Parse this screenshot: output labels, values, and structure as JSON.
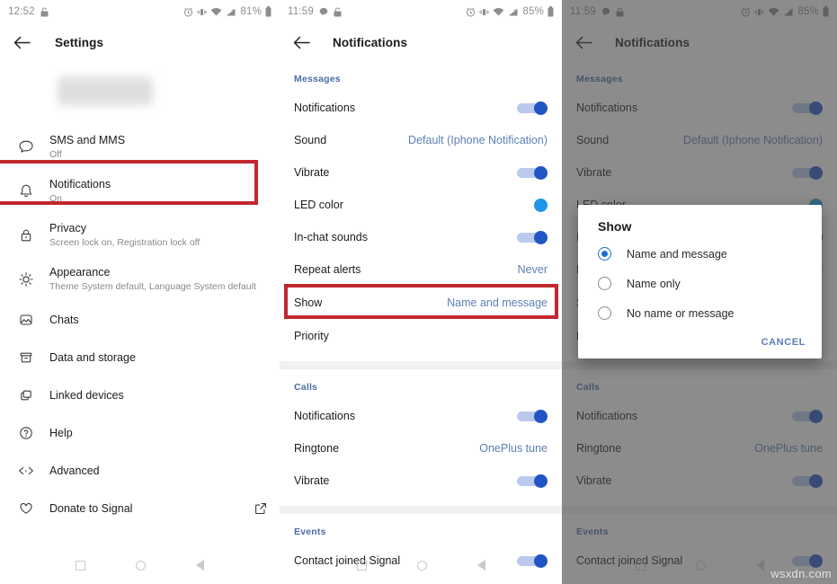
{
  "colors": {
    "accent_blue": "#5b7fb5",
    "section_header": "#4a6fa5",
    "toggle_on": "#2255c4",
    "led_dot": "#1f95e8",
    "highlight_red": "#c1272d",
    "radio_selected": "#1f6fd4"
  },
  "panel_settings": {
    "statusbar": {
      "time": "12:52",
      "battery_percent": "81%",
      "left_icons": [
        "lock-icon"
      ],
      "right_icons": [
        "alarm-icon",
        "vibrate-icon",
        "wifi-icon",
        "signal-icon",
        "battery-icon"
      ]
    },
    "appbar": {
      "title": "Settings",
      "back_icon": "back-arrow-icon"
    },
    "profile": {
      "name_blurred": ""
    },
    "items": [
      {
        "icon": "chat-bubble-icon",
        "title": "SMS and MMS",
        "subtitle": "Off",
        "highlighted": false,
        "external": false
      },
      {
        "icon": "bell-icon",
        "title": "Notifications",
        "subtitle": "On",
        "highlighted": true,
        "external": false
      },
      {
        "icon": "lock-icon",
        "title": "Privacy",
        "subtitle": "Screen lock on, Registration lock off",
        "highlighted": false,
        "external": false
      },
      {
        "icon": "brightness-icon",
        "title": "Appearance",
        "subtitle": "Theme System default, Language System default",
        "highlighted": false,
        "external": false
      },
      {
        "icon": "image-icon",
        "title": "Chats",
        "subtitle": "",
        "highlighted": false,
        "external": false
      },
      {
        "icon": "archive-icon",
        "title": "Data and storage",
        "subtitle": "",
        "highlighted": false,
        "external": false
      },
      {
        "icon": "devices-icon",
        "title": "Linked devices",
        "subtitle": "",
        "highlighted": false,
        "external": false
      },
      {
        "icon": "help-icon",
        "title": "Help",
        "subtitle": "",
        "highlighted": false,
        "external": false
      },
      {
        "icon": "code-icon",
        "title": "Advanced",
        "subtitle": "",
        "highlighted": false,
        "external": false
      },
      {
        "icon": "heart-icon",
        "title": "Donate to Signal",
        "subtitle": "",
        "highlighted": false,
        "external": true
      }
    ],
    "navbar": [
      "square-icon",
      "circle-icon",
      "triangle-back-icon"
    ]
  },
  "panel_notifications": {
    "statusbar": {
      "time": "11:59",
      "battery_percent": "85%",
      "left_icons": [
        "message-icon",
        "lock-icon"
      ],
      "right_icons": [
        "alarm-icon",
        "vibrate-icon",
        "wifi-icon",
        "signal-icon",
        "battery-icon"
      ]
    },
    "appbar": {
      "title": "Notifications",
      "back_icon": "back-arrow-icon"
    },
    "sections": [
      {
        "header": "Messages",
        "rows": [
          {
            "label": "Notifications",
            "type": "toggle",
            "value": "on"
          },
          {
            "label": "Sound",
            "type": "value",
            "value": "Default (Iphone Notification)"
          },
          {
            "label": "Vibrate",
            "type": "toggle",
            "value": "on"
          },
          {
            "label": "LED color",
            "type": "color-dot",
            "value": "blue"
          },
          {
            "label": "In-chat sounds",
            "type": "toggle",
            "value": "on"
          },
          {
            "label": "Repeat alerts",
            "type": "value",
            "value": "Never"
          },
          {
            "label": "Show",
            "type": "value",
            "value": "Name and message",
            "highlighted": true
          },
          {
            "label": "Priority",
            "type": "plain",
            "value": ""
          }
        ]
      },
      {
        "header": "Calls",
        "rows": [
          {
            "label": "Notifications",
            "type": "toggle",
            "value": "on"
          },
          {
            "label": "Ringtone",
            "type": "value",
            "value": "OnePlus tune"
          },
          {
            "label": "Vibrate",
            "type": "toggle",
            "value": "on"
          }
        ]
      },
      {
        "header": "Events",
        "rows": [
          {
            "label": "Contact joined Signal",
            "type": "toggle",
            "value": "on"
          }
        ]
      }
    ],
    "navbar": [
      "square-icon",
      "circle-icon",
      "triangle-back-icon"
    ]
  },
  "panel_dialog": {
    "dialog": {
      "title": "Show",
      "options": [
        {
          "label": "Name and message",
          "selected": true
        },
        {
          "label": "Name only",
          "selected": false
        },
        {
          "label": "No name or message",
          "selected": false
        }
      ],
      "cancel_label": "CANCEL"
    }
  },
  "watermark": "wsxdn.com"
}
